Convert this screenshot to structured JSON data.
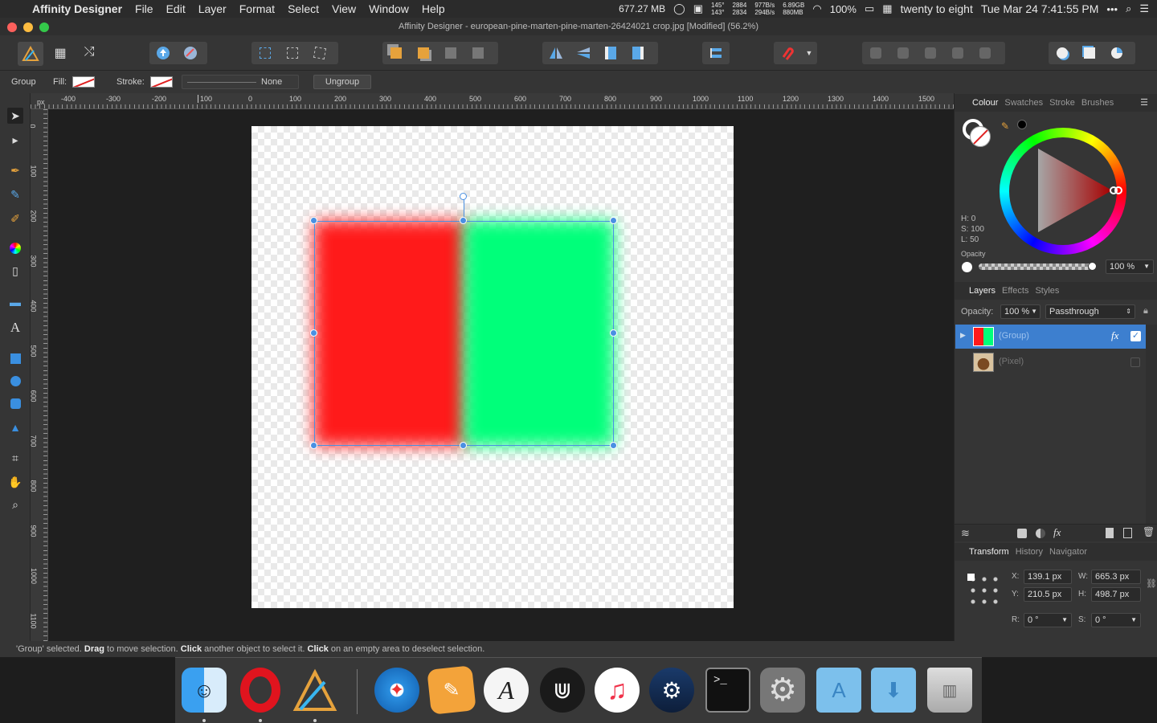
{
  "menubar": {
    "app": "Affinity Designer",
    "items": [
      "File",
      "Edit",
      "Layer",
      "Format",
      "Select",
      "View",
      "Window",
      "Help"
    ],
    "memory": "677.27 MB",
    "sensor_a": [
      "145°",
      "143°"
    ],
    "sensor_b": [
      "2884",
      "2834"
    ],
    "net_a": [
      "977B/s",
      "294B/s"
    ],
    "net_b": [
      "6.89GB",
      "880MB"
    ],
    "battery": "100%",
    "clock_words": "twenty to eight",
    "datetime": "Tue Mar 24  7:41:55 PM"
  },
  "window": {
    "title": "Affinity Designer - european-pine-marten-pine-marten-26424021 crop.jpg [Modified] (56.2%)"
  },
  "context": {
    "selection_type": "Group",
    "fill_label": "Fill:",
    "stroke_label": "Stroke:",
    "stroke_style": "None",
    "ungroup_label": "Ungroup"
  },
  "ruler": {
    "unit": "px",
    "h_ticks": [
      "-400",
      "-300",
      "-200",
      "100",
      "0",
      "100",
      "200",
      "300",
      "400",
      "500",
      "600",
      "700",
      "800",
      "900",
      "1000",
      "1100",
      "1200",
      "1300",
      "1400",
      "1500"
    ],
    "v_ticks": [
      "0",
      "100",
      "200",
      "300",
      "400",
      "500",
      "600",
      "700",
      "800",
      "900",
      "1000",
      "1100"
    ]
  },
  "canvas": {
    "colors": {
      "red": "#ff1a1a",
      "green": "#00ff7a",
      "selection": "#4a90e2"
    }
  },
  "status": {
    "quoted": "'Group' selected. ",
    "drag": "Drag",
    "drag_text": " to move selection. ",
    "click": "Click",
    "click_text": " another object to select it. ",
    "click2": "Click",
    "click2_text": " on an empty area to deselect selection."
  },
  "colour_panel": {
    "tabs": [
      "Colour",
      "Swatches",
      "Stroke",
      "Brushes"
    ],
    "h": "H: 0",
    "s": "S: 100",
    "l": "L: 50",
    "opacity_label": "Opacity",
    "opacity_value": "100 %"
  },
  "layers_panel": {
    "tabs": [
      "Layers",
      "Effects",
      "Styles"
    ],
    "opacity_label": "Opacity:",
    "opacity_value": "100 %",
    "blend_mode": "Passthrough",
    "layers": [
      {
        "name": "(Group)",
        "fx": "fx",
        "visible": true
      },
      {
        "name": "(Pixel)",
        "visible": false
      }
    ]
  },
  "transform_panel": {
    "tabs": [
      "Transform",
      "History",
      "Navigator"
    ],
    "x_label": "X:",
    "x": "139.1 px",
    "y_label": "Y:",
    "y": "210.5 px",
    "w_label": "W:",
    "w": "665.3 px",
    "h_label": "H:",
    "h": "498.7 px",
    "r_label": "R:",
    "r": "0 °",
    "s_label": "S:",
    "s": "0 °"
  },
  "dock": {
    "apps": [
      "finder-icon",
      "opera-icon",
      "affinity-designer-icon",
      "safari-icon",
      "pages-icon",
      "scrivener-icon",
      "ulysses-icon",
      "music-icon",
      "steam-icon",
      "terminal-icon",
      "system-preferences-icon",
      "applications-folder-icon",
      "downloads-folder-icon",
      "trash-icon"
    ]
  }
}
